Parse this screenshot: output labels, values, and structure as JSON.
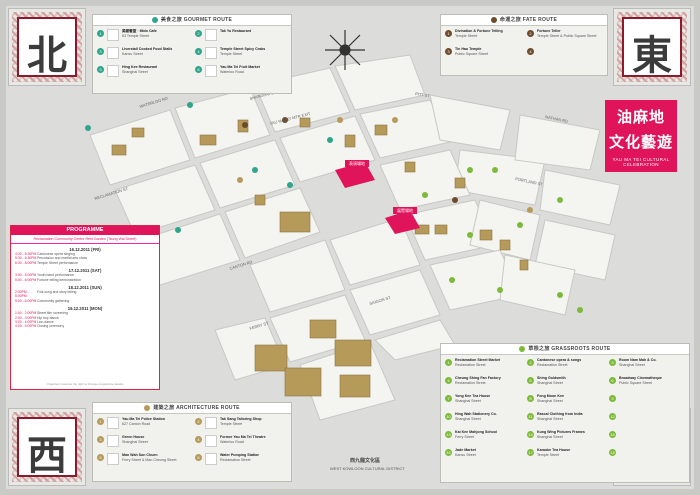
{
  "title": {
    "line1": "油麻地",
    "line2": "文化藝遊",
    "english": "YAU MA TEI CULTURAL CELEBRATION"
  },
  "corners": {
    "top_left": "北",
    "top_right": "東",
    "bottom_left": "西",
    "bottom_right": "南"
  },
  "gourmet": {
    "header": "美食之旅 GOURMET ROUTE",
    "items": [
      {
        "n": "1",
        "name": "美都餐室 · Mido Cafe",
        "addr": "63 Temple Street"
      },
      {
        "n": "2",
        "name": "Tak Yu Restaurant",
        "addr": ""
      },
      {
        "n": "3",
        "name": "Liverstall Cooked Food Stalls",
        "addr": "Kansu Street"
      },
      {
        "n": "4",
        "name": "Temple Street Spicy Crabs",
        "addr": "Temple Street"
      },
      {
        "n": "5",
        "name": "Hing Kee Restaurant",
        "addr": "Shanghai Street"
      },
      {
        "n": "6",
        "name": "Yau Ma Tei Fruit Market",
        "addr": "Waterloo Road"
      }
    ]
  },
  "fate": {
    "header": "命運之旅 FATE ROUTE",
    "items": [
      {
        "n": "1",
        "name": "Divination & Fortune Telling",
        "addr": "Temple Street"
      },
      {
        "n": "2",
        "name": "Fortune Teller",
        "addr": "Temple Street & Public Square Street"
      },
      {
        "n": "3",
        "name": "Tin Hau Temple",
        "addr": "Public Square Street"
      },
      {
        "n": "4",
        "name": "",
        "addr": ""
      }
    ]
  },
  "architecture": {
    "header": "建築之旅 ARCHITECTURE ROUTE",
    "items": [
      {
        "n": "1",
        "name": "Yau Ma Tei Police Station",
        "addr": "627 Canton Road"
      },
      {
        "n": "2",
        "name": "Tak Sang Tailoring Shop",
        "addr": "Temple Street"
      },
      {
        "n": "3",
        "name": "Green House",
        "addr": "Shanghai Street"
      },
      {
        "n": "4",
        "name": "Former Yau Ma Tei Theatre",
        "addr": "Waterloo Road"
      },
      {
        "n": "5",
        "name": "Man Wah Sun Chuen",
        "addr": "Ferry Street & Man Cheong Street"
      },
      {
        "n": "6",
        "name": "Water Pumping Station",
        "addr": "Reclamation Street"
      }
    ]
  },
  "grassroots": {
    "header": "草根之旅 GRASSROOTS ROUTE",
    "items": [
      {
        "n": "1",
        "name": "Reclamation Street Market",
        "addr": "Reclamation Street"
      },
      {
        "n": "2",
        "name": "Cantonese opera & songs",
        "addr": "Reclamation Street"
      },
      {
        "n": "3",
        "name": "Room Nam Mah & Co.",
        "addr": "Shanghai Street"
      },
      {
        "n": "4",
        "name": "Cheung Shing Fan Factory",
        "addr": "Reclamation Street"
      },
      {
        "n": "5",
        "name": "Shing Goldsmith",
        "addr": "Shanghai Street"
      },
      {
        "n": "6",
        "name": "Broadway Cinematheque",
        "addr": "Public Square Street"
      },
      {
        "n": "7",
        "name": "Yong Kee Tea House",
        "addr": "Shanghai Street"
      },
      {
        "n": "8",
        "name": "Fong Moon Kee",
        "addr": "Shanghai Street"
      },
      {
        "n": "9",
        "name": "",
        "addr": ""
      },
      {
        "n": "10",
        "name": "Hing Wah Stationery Co.",
        "addr": "Shanghai Street"
      },
      {
        "n": "11",
        "name": "Rascal Clothing from India",
        "addr": "Shanghai Street"
      },
      {
        "n": "12",
        "name": "",
        "addr": ""
      },
      {
        "n": "13",
        "name": "Kai Kee Mahjong School",
        "addr": "Ferry Street"
      },
      {
        "n": "14",
        "name": "Kung Wing Pictures Frames",
        "addr": "Shanghai Street"
      },
      {
        "n": "15",
        "name": "",
        "addr": ""
      },
      {
        "n": "16",
        "name": "Jade Market",
        "addr": "Kansu Street"
      },
      {
        "n": "17",
        "name": "Karaoke Tea House",
        "addr": "Temple Street"
      },
      {
        "n": "18",
        "name": "",
        "addr": ""
      }
    ]
  },
  "programme": {
    "header": "PROGRAMME",
    "venue": "Reclamation Community Centre Rest Garden (Tsung Wai Street)",
    "days": [
      {
        "date": "16.12.2011 (FRI)",
        "rows": [
          {
            "time": "4:30 - 5:30PM",
            "event": "Cantonese opera singing"
          },
          {
            "time": "5:30 - 6:30PM",
            "event": "Percussion and martial arts show"
          },
          {
            "time": "6:30 - 8:00PM",
            "event": "Temple Street performance"
          }
        ]
      },
      {
        "date": "17.12.2011 (SAT)",
        "rows": [
          {
            "time": "3:00 - 5:00PM",
            "event": "Youth band performance"
          },
          {
            "time": "5:00 - 6:00PM",
            "event": "Fortune telling demonstration"
          }
        ]
      },
      {
        "date": "18.12.2011 (SUN)",
        "rows": [
          {
            "time": "2:00PM - 5:00PM",
            "event": "Folk song and story telling"
          },
          {
            "time": "5:00 - 6:00PM",
            "event": "Community gathering"
          }
        ]
      },
      {
        "date": "19.12.2011 (MON)",
        "rows": [
          {
            "time": "1:00 - 2:00PM",
            "event": "Street film screening"
          },
          {
            "time": "2:00 - 3:00PM",
            "event": "Hip hop dance"
          },
          {
            "time": "3:00 - 4:00PM",
            "event": "Lion dance"
          },
          {
            "time": "4:00 - 5:00PM",
            "event": "Closing ceremony"
          }
        ]
      }
    ],
    "footer": "Organiser reserves the right to change programme details"
  },
  "map_labels": {
    "performance": "表演場地",
    "exhibition": "展覽場地",
    "district": "西九龍文化區",
    "district_en": "WEST KOWLOON CULTURAL DISTRICT",
    "streets": [
      "WATERLOO RD",
      "SHANGHAI ST",
      "TEMPLE ST",
      "NATHAN RD",
      "PORTLAND ST",
      "RECLAMATION ST",
      "CANTON RD",
      "FERRY ST",
      "KANSU ST",
      "PITT ST",
      "HAMILTON ST",
      "TUNG KUN ST",
      "SAIGON ST",
      "JORDAN RD",
      "MAN CHEONG ST",
      "PUBLIC SQUARE ST",
      "YAU MA TEI MTR EXIT"
    ]
  },
  "colors": {
    "gourmet": "#2fa58a",
    "fate": "#6d4b2c",
    "architecture": "#b59a5a",
    "grassroots": "#7dba3a",
    "accent": "#e0145a"
  }
}
